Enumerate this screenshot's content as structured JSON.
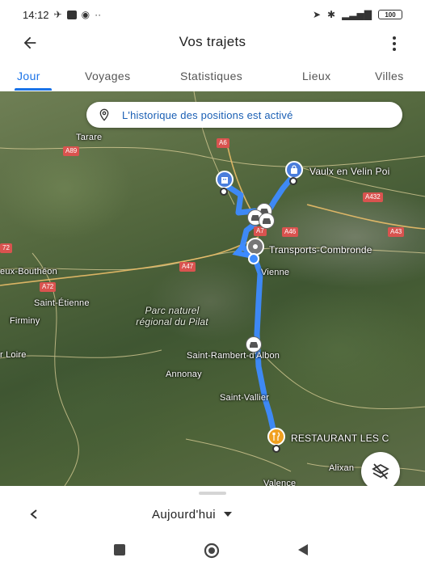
{
  "status_bar": {
    "time": "14:12",
    "battery": "100"
  },
  "app_bar": {
    "title": "Vos trajets"
  },
  "tabs": [
    {
      "label": "Jour",
      "active": true
    },
    {
      "label": "Voyages",
      "active": false
    },
    {
      "label": "Statistiques",
      "active": false
    },
    {
      "label": "Lieux",
      "active": false
    },
    {
      "label": "Villes",
      "active": false
    }
  ],
  "map": {
    "banner_text": "L'historique des positions est activé",
    "places": {
      "tarare": "Tarare",
      "vaulx": "Vaulx en Velin Poi",
      "transports": "Transports-Combronde",
      "vienne": "Vienne",
      "boutheon": "eux-Bouthéon",
      "saint_etienne": "Saint-Étienne",
      "firminy": "Firminy",
      "pilat": "Parc naturel régional du Pilat",
      "saint_rambert": "Saint-Rambert-d'Albon",
      "annonay": "Annonay",
      "saint_vallier": "Saint-Vallier",
      "restaurant": "RESTAURANT LES C",
      "loire": "r Loire",
      "alixan": "Alixan",
      "valence": "Valence"
    },
    "roads": {
      "a89": "A89",
      "a6": "A6",
      "a432": "A432",
      "a7": "A7",
      "a46": "A46",
      "a43": "A43",
      "a72_left": "72",
      "a47": "A47",
      "a72": "A72"
    },
    "route_color": "#3d8bff"
  },
  "bottom_sheet": {
    "date_label": "Aujourd'hui"
  }
}
